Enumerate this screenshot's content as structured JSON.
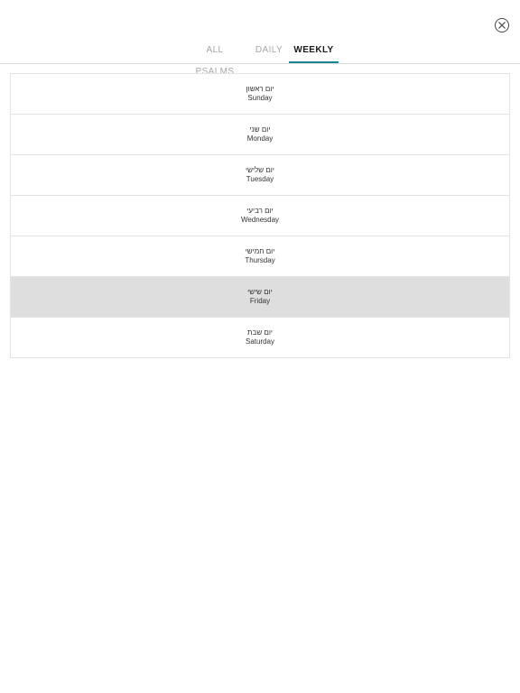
{
  "tabs": [
    {
      "label": "ALL PSALMS",
      "active": false
    },
    {
      "label": "DAILY",
      "active": false
    },
    {
      "label": "WEEKLY",
      "active": true
    }
  ],
  "accent_color": "#17868f",
  "selected_row_color": "#dedede",
  "close_icon": "close-circle-icon",
  "days": [
    {
      "hebrew": "יום ראשון",
      "english": "Sunday",
      "selected": false
    },
    {
      "hebrew": "יום שני",
      "english": "Monday",
      "selected": false
    },
    {
      "hebrew": "יום שלישי",
      "english": "Tuesday",
      "selected": false
    },
    {
      "hebrew": "יום רביעי",
      "english": "Wednesday",
      "selected": false
    },
    {
      "hebrew": "יום חמישי",
      "english": "Thursday",
      "selected": false
    },
    {
      "hebrew": "יום שישי",
      "english": "Friday",
      "selected": true
    },
    {
      "hebrew": "יום שבת",
      "english": "Saturday",
      "selected": false
    }
  ]
}
